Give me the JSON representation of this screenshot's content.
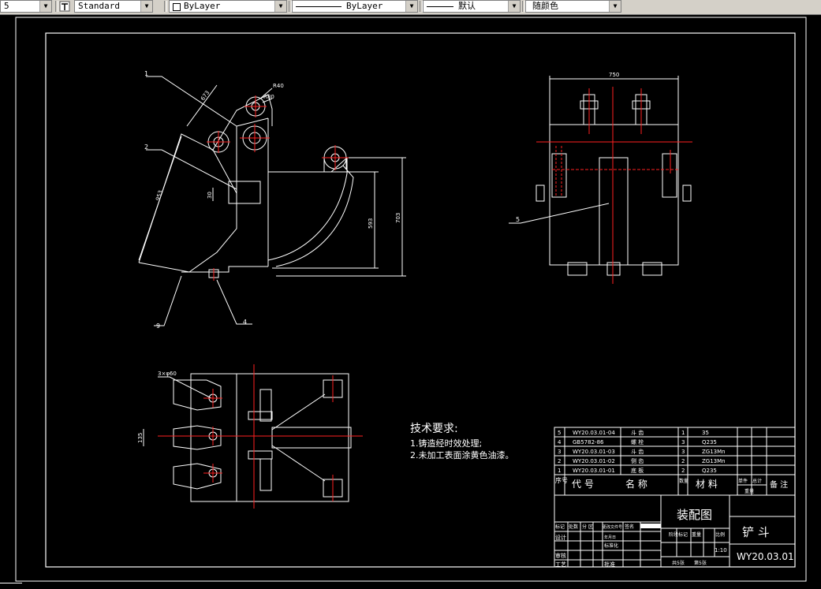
{
  "toolbar": {
    "layer_value": "5",
    "text_style": "Standard",
    "color": "ByLayer",
    "linetype": "ByLayer",
    "lineweight": "默认",
    "plot_style": "随颜色"
  },
  "front_view": {
    "callouts": [
      "1",
      "2",
      "9",
      "4"
    ],
    "dims": {
      "d1": "673",
      "r40": "R40",
      "r80": "R80",
      "d2": "953",
      "d3": "30",
      "h1": "593",
      "h2": "703"
    }
  },
  "side_view": {
    "width_dim": "750",
    "callout": "5"
  },
  "top_view": {
    "holes": "3×φ60",
    "dim": "135"
  },
  "tech_req": {
    "title": "技术要求:",
    "items": [
      "1.铸造经时效处理;",
      "2.未加工表面涂黄色油漆。"
    ]
  },
  "bom": {
    "rows": [
      {
        "no": "5",
        "code": "WY20.03.01-04",
        "name": "斗 齿",
        "qty": "1",
        "material": "35"
      },
      {
        "no": "4",
        "code": "GB5782-86",
        "name": "螺 栓",
        "qty": "3",
        "material": "Q235"
      },
      {
        "no": "3",
        "code": "WY20.03.01-03",
        "name": "斗 齿",
        "qty": "3",
        "material": "ZG13Mn"
      },
      {
        "no": "2",
        "code": "WY20.03.01-02",
        "name": "侧 齿",
        "qty": "2",
        "material": "ZG13Mn"
      },
      {
        "no": "1",
        "code": "WY20.03.01-01",
        "name": "底 板",
        "qty": "2",
        "material": "Q235"
      }
    ],
    "header": {
      "no": "序号",
      "code": "代 号",
      "name": "名 称",
      "qty": "数量",
      "material": "材 料",
      "unit_weight": "单件",
      "total_weight": "总计",
      "weight": "重量",
      "note": "备 注"
    }
  },
  "title_block": {
    "drawing_title": "装配图",
    "part_name": "铲 斗",
    "drawing_no": "WY20.03.01",
    "scale": "1:10",
    "rev_row": [
      "标记",
      "处数",
      "分 区",
      "更改文件号",
      "签名",
      "年月日"
    ],
    "roles": [
      "设计",
      "审核",
      "工艺"
    ],
    "std": "标准化",
    "approve": "批准",
    "stage": "阶段标记",
    "weight": "重量",
    "ratio": "比例",
    "sheets": "共5张",
    "sheet": "第5张"
  }
}
